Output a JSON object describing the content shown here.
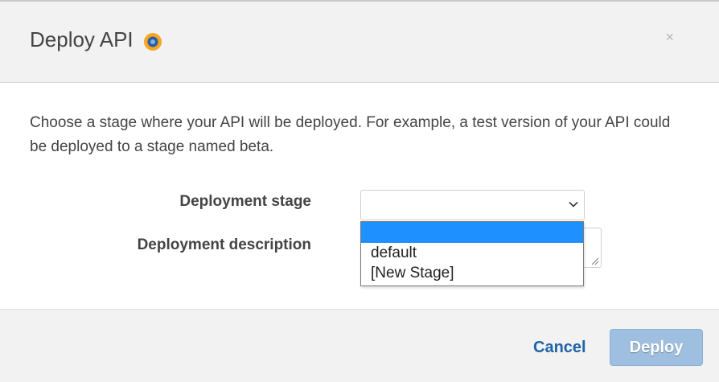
{
  "dialog": {
    "title": "Deploy API",
    "close_glyph": "×",
    "info_icon": "info-icon",
    "accent_color": "#f5a623",
    "description": "Choose a stage where your API will be deployed. For example, a test version of your API could be deployed to a stage named beta."
  },
  "form": {
    "stage_label": "Deployment stage",
    "description_label": "Deployment description",
    "stage_value": "",
    "stage_options": [
      "",
      "default",
      "[New Stage]"
    ],
    "highlighted_option_index": 0,
    "description_value": ""
  },
  "footer": {
    "cancel_label": "Cancel",
    "deploy_label": "Deploy",
    "link_color": "#1f63a8",
    "deploy_color": "#9fbfe0"
  }
}
